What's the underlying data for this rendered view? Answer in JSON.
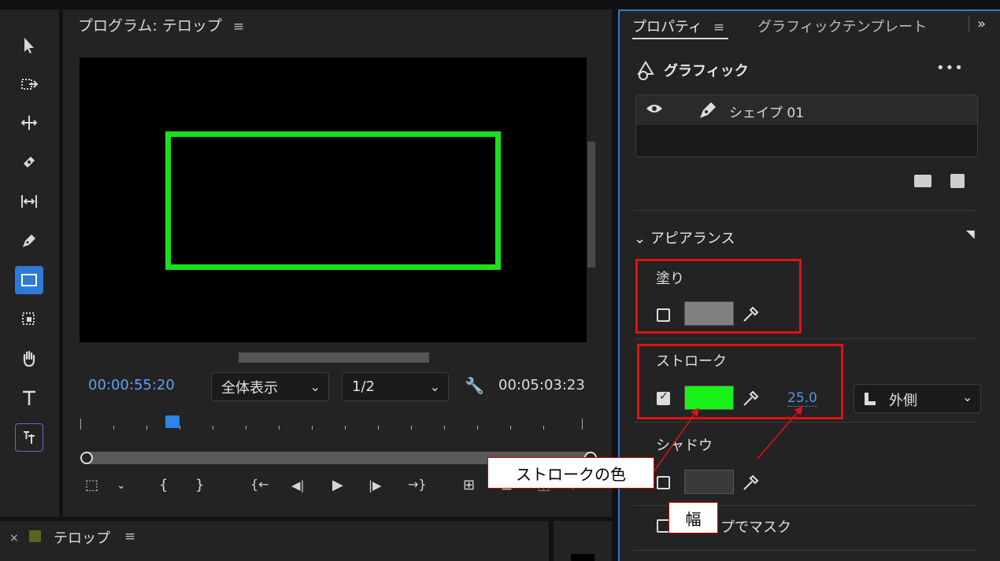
{
  "program": {
    "title": "プログラム: テロップ",
    "menu_icon": "≡",
    "timecode_current": "00:00:55:20",
    "zoom_select": "全体表示",
    "resolution_select": "1/2",
    "timecode_duration": "00:05:03:23"
  },
  "tools": [
    {
      "name": "selection-tool-icon"
    },
    {
      "name": "track-select-tool-icon"
    },
    {
      "name": "ripple-edit-tool-icon"
    },
    {
      "name": "razor-tool-icon"
    },
    {
      "name": "slip-tool-icon"
    },
    {
      "name": "pen-tool-icon"
    },
    {
      "name": "rectangle-tool-icon"
    },
    {
      "name": "remix-tool-icon"
    },
    {
      "name": "hand-tool-icon"
    },
    {
      "name": "type-tool-icon"
    },
    {
      "name": "vertical-type-tool-icon"
    }
  ],
  "transport": {
    "mark_in": "{",
    "mark_out": "}",
    "go_in": "{←",
    "step_back": "◀|",
    "play": "▶",
    "step_forward": "|▶",
    "go_out": "→}"
  },
  "timeline": {
    "close": "×",
    "name": "テロップ",
    "menu_icon": "≡",
    "swatch_color": "#55651a"
  },
  "properties": {
    "tab_active": "プロパティ",
    "tab_menu": "≡",
    "tab_other": "グラフィックテンプレート",
    "more": "»",
    "graphic_title": "グラフィック",
    "graphic_more": "•••",
    "layer_name": "シェイプ 01",
    "appearance_title": "アピアランス",
    "fill": {
      "label": "塗り",
      "checked": false,
      "color": "#808080"
    },
    "stroke": {
      "label": "ストローク",
      "checked": true,
      "color": "#19f219",
      "width": "25.0",
      "position": "外側"
    },
    "shadow": {
      "label": "シャドウ",
      "checked": false,
      "color": "#3a3a3a"
    },
    "mask": {
      "label": "シェイプでマスク",
      "checked": false
    }
  },
  "annotations": {
    "stroke_color_callout": "ストロークの色",
    "width_callout": "幅",
    "highlight_color": "#e21111"
  }
}
